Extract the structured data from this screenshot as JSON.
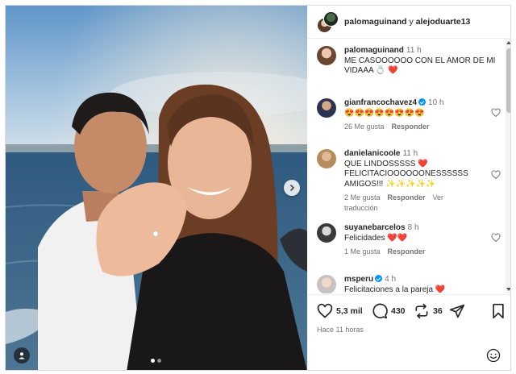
{
  "header": {
    "user1": "palomaguinand",
    "connector": " y ",
    "user2": "alejoduarte13"
  },
  "caption": {
    "username": "palomaguinand",
    "time": "11 h",
    "text": "ME CASOOOOOO CON EL AMOR DE MI VIDAAA 💍 ❤️"
  },
  "comments": [
    {
      "username": "gianfrancochavez4",
      "verified": true,
      "time": "10 h",
      "text": "😍😍😍😍😍😍😍😍",
      "likes": "26 Me gusta",
      "reply": "Responder",
      "translation": ""
    },
    {
      "username": "danielanicoole",
      "verified": false,
      "time": "11 h",
      "text": "QUE LINDOSSSSS ❤️ FELICITACIOOOOOONESSSSSS AMIGOS!!! ✨✨✨✨✨",
      "likes": "2 Me gusta",
      "reply": "Responder",
      "translation": "Ver traducción"
    },
    {
      "username": "suyanebarcelos",
      "verified": false,
      "time": "8 h",
      "text": "Felicidades ❤️❤️",
      "likes": "1 Me gusta",
      "reply": "Responder",
      "translation": ""
    },
    {
      "username": "msperu",
      "verified": true,
      "time": "4 h",
      "text": "Felicitaciones a la pareja ❤️",
      "likes": "",
      "reply": "",
      "translation": ""
    }
  ],
  "actions": {
    "likes": "5,3 mil",
    "comments": "430",
    "reposts": "36"
  },
  "posted": "Hace 11 horas",
  "icons": [
    "heart-icon",
    "comment-icon",
    "repost-icon",
    "share-icon",
    "save-icon",
    "emoji-icon",
    "next-arrow-icon",
    "user-tag-icon"
  ],
  "colors": {
    "accent": "#0095f6",
    "like": "#ed4956",
    "muted": "#737373",
    "text": "#262626"
  }
}
